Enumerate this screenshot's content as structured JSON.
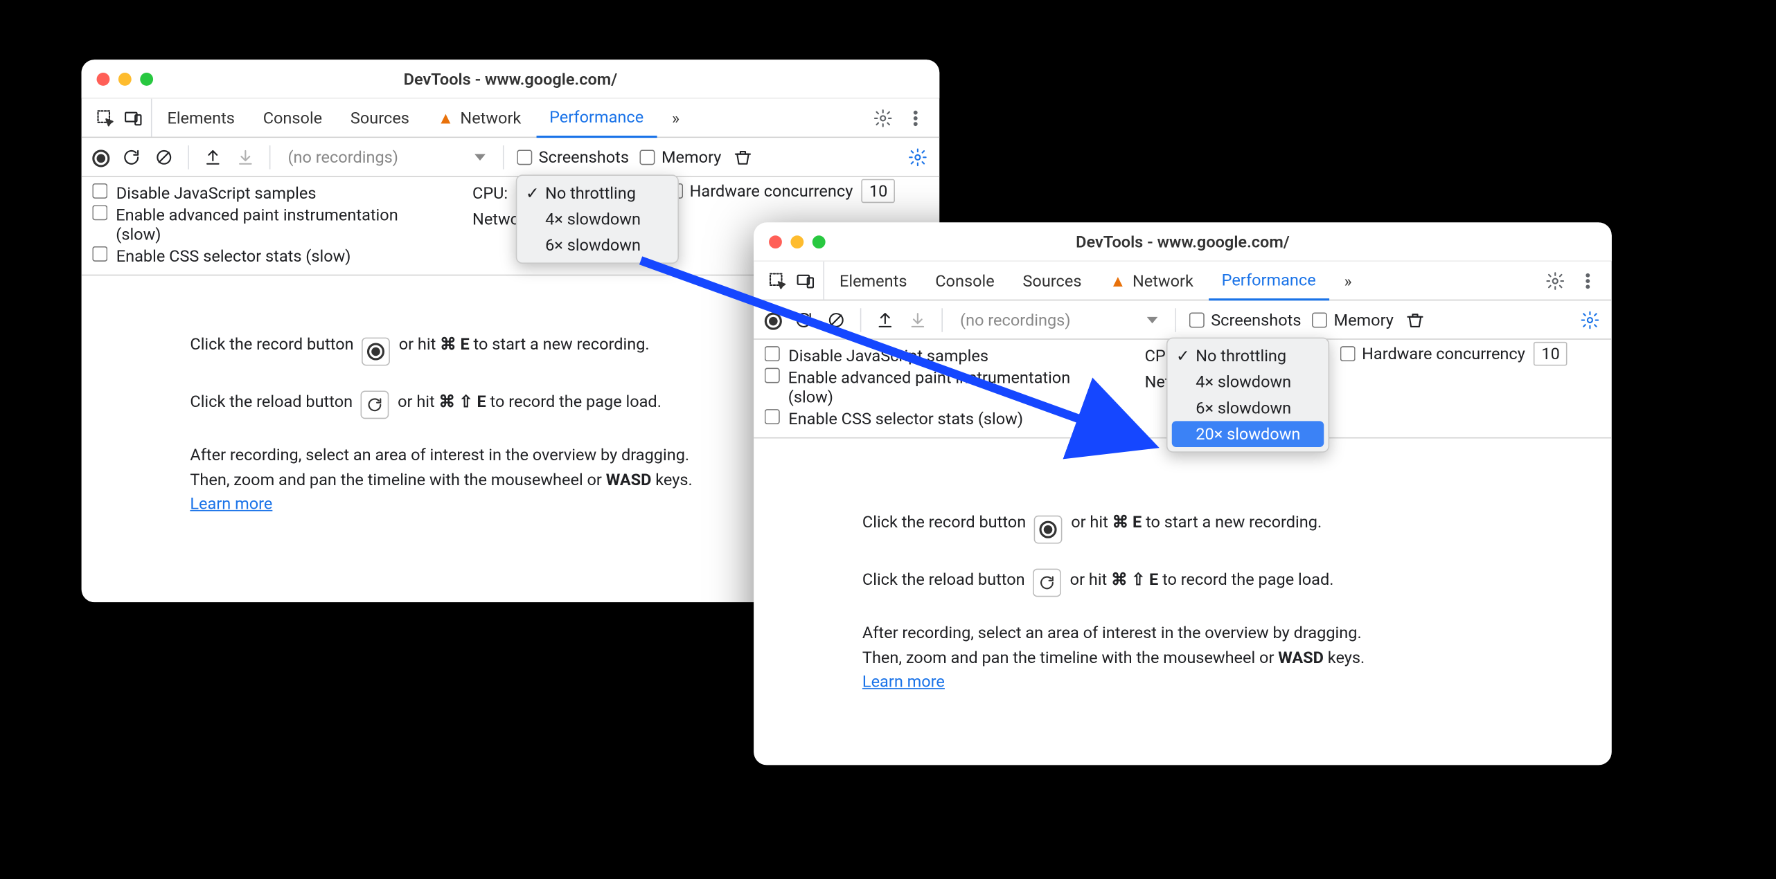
{
  "window_title": "DevTools - www.google.com/",
  "tabs": {
    "elements": "Elements",
    "console": "Console",
    "sources": "Sources",
    "network": "Network",
    "performance": "Performance"
  },
  "toolbar": {
    "recordings_placeholder": "(no recordings)",
    "screenshots": "Screenshots",
    "memory": "Memory"
  },
  "settings": {
    "disable_js": "Disable JavaScript samples",
    "adv_paint": "Enable advanced paint instrumentation (slow)",
    "css_stats": "Enable CSS selector stats (slow)",
    "cpu_label": "CPU:",
    "network_label": "Network:",
    "hw_label": "Hardware concurrency",
    "hw_value": "10"
  },
  "cpu_menu_a": {
    "no_throttle": "No throttling",
    "x4": "4× slowdown",
    "x6": "6× slowdown"
  },
  "cpu_menu_b": {
    "no_throttle": "No throttling",
    "x4": "4× slowdown",
    "x6": "6× slowdown",
    "x20": "20× slowdown"
  },
  "instructions": {
    "record_pre": "Click the record button ",
    "record_post": " or hit ",
    "record_key": "⌘ E",
    "record_tail": " to start a new recording.",
    "reload_pre": "Click the reload button ",
    "reload_post": " or hit ",
    "reload_key": "⌘ ⇧ E",
    "reload_tail": " to record the page load.",
    "after1": "After recording, select an area of interest in the overview by dragging.",
    "after2_pre": "Then, zoom and pan the timeline with the mousewheel or ",
    "after2_key": "WASD",
    "after2_post": " keys.",
    "learn": "Learn more"
  }
}
